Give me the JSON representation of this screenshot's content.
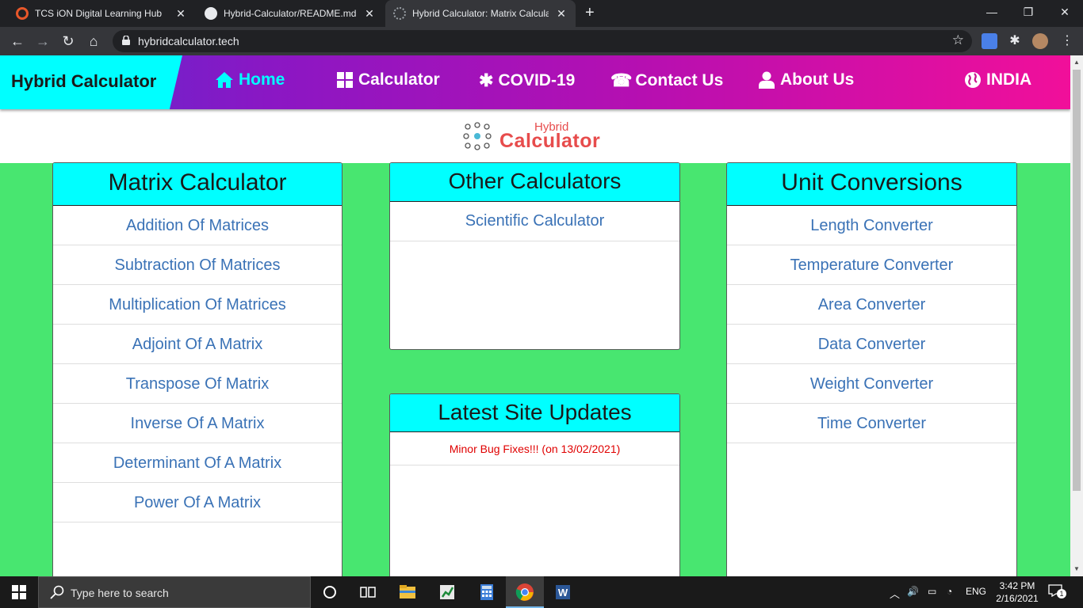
{
  "browser": {
    "tabs": [
      {
        "title": "TCS iON Digital Learning Hub",
        "active": false
      },
      {
        "title": "Hybrid-Calculator/README.md at",
        "active": false
      },
      {
        "title": "Hybrid Calculator: Matrix Calculat",
        "active": true
      }
    ],
    "url": "hybridcalculator.tech"
  },
  "site": {
    "brand": "Hybrid Calculator",
    "nav": [
      {
        "label": "Home",
        "icon": "home-icon",
        "active": true
      },
      {
        "label": "Calculator",
        "icon": "grid-icon",
        "active": false
      },
      {
        "label": "COVID-19",
        "icon": "asterisk-icon",
        "active": false
      },
      {
        "label": "Contact Us",
        "icon": "phone-icon",
        "active": false
      },
      {
        "label": "About Us",
        "icon": "user-icon",
        "active": false
      }
    ],
    "region": "INDIA",
    "logo": {
      "small": "Hybrid",
      "big": "Calculator"
    },
    "matrix": {
      "title": "Matrix Calculator",
      "items": [
        "Addition Of Matrices",
        "Subtraction Of Matrices",
        "Multiplication Of Matrices",
        "Adjoint Of A Matrix",
        "Transpose Of Matrix",
        "Inverse Of A Matrix",
        "Determinant Of A Matrix",
        "Power Of A Matrix"
      ]
    },
    "other": {
      "title": "Other Calculators",
      "items": [
        "Scientific Calculator"
      ]
    },
    "updates": {
      "title": "Latest Site Updates",
      "items": [
        "Minor Bug Fixes!!! (on 13/02/2021)"
      ]
    },
    "units": {
      "title": "Unit Conversions",
      "items": [
        "Length Converter",
        "Temperature Converter",
        "Area Converter",
        "Data Converter",
        "Weight Converter",
        "Time Converter"
      ]
    }
  },
  "taskbar": {
    "search_placeholder": "Type here to search",
    "language": "ENG",
    "time": "3:42 PM",
    "date": "2/16/2021",
    "notifications": "1"
  },
  "colors": {
    "brand_bg": "#00ffff",
    "nav_gradient_start": "#5b2bd0",
    "nav_gradient_end": "#f10f9a",
    "page_green": "#48e670",
    "link_blue": "#3a72b6",
    "update_red": "#e00000",
    "logo_red": "#e74c4c"
  }
}
